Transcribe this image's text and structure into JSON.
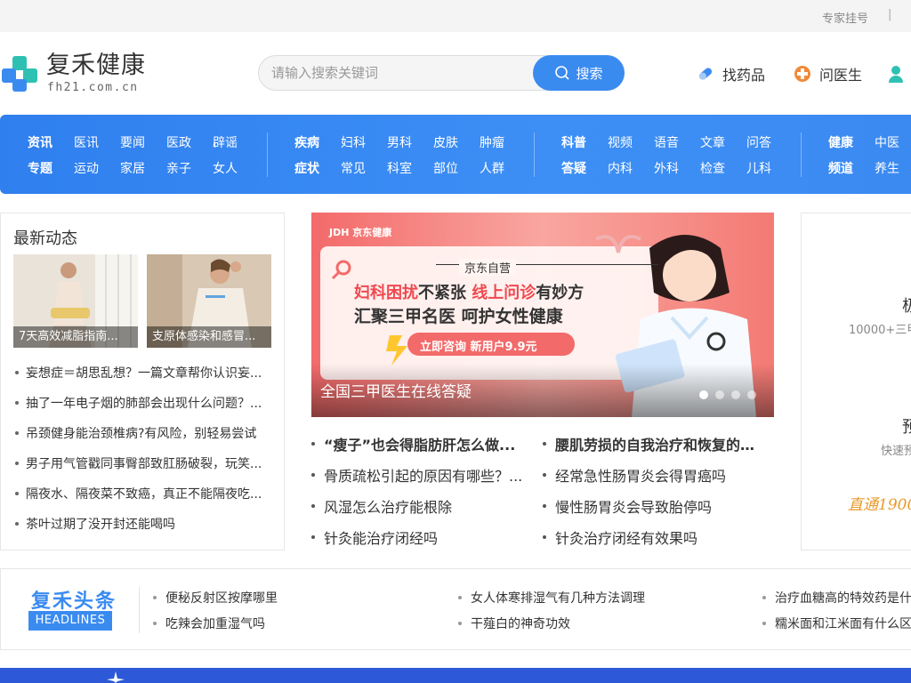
{
  "topbar": {
    "register": "专家挂号",
    "separator": "|"
  },
  "logo": {
    "name": "复禾健康",
    "domain": "fh21.com.cn"
  },
  "search": {
    "placeholder": "请输入搜索关键词",
    "button": "搜索"
  },
  "header_links": [
    {
      "label": "找药品",
      "icon": "pill-icon"
    },
    {
      "label": "问医生",
      "icon": "doctor-icon"
    }
  ],
  "nav": {
    "groups": [
      {
        "row1": [
          "资讯",
          "医讯",
          "要闻",
          "医政",
          "辟谣"
        ],
        "row2": [
          "专题",
          "运动",
          "家居",
          "亲子",
          "女人"
        ]
      },
      {
        "row1": [
          "疾病",
          "妇科",
          "男科",
          "皮肤",
          "肿瘤"
        ],
        "row2": [
          "症状",
          "常见",
          "科室",
          "部位",
          "人群"
        ]
      },
      {
        "row1": [
          "科普",
          "视频",
          "语音",
          "文章",
          "问答"
        ],
        "row2": [
          "答疑",
          "内科",
          "外科",
          "检查",
          "儿科"
        ]
      },
      {
        "row1": [
          "健康",
          "中医"
        ],
        "row2": [
          "频道",
          "养生"
        ]
      }
    ]
  },
  "latest": {
    "title": "最新动态",
    "thumbs": [
      "7天高效减脂指南...",
      "支原体感染和感冒..."
    ],
    "items": [
      "妄想症＝胡思乱想？一篇文章帮你认识妄...",
      "抽了一年电子烟的肺部会出现什么问题？...",
      "吊颈健身能治颈椎病?有风险，别轻易尝试",
      "男子用气管戳同事臀部致肛肠破裂，玩笑...",
      "隔夜水、隔夜菜不致癌，真正不能隔夜吃...",
      "茶叶过期了没开封还能喝吗"
    ]
  },
  "banner": {
    "brand": "JDH 京东健康",
    "tagline": "京东自营",
    "line1a": "妇科困扰",
    "line1b": "不紧张",
    "line1c": "线上问诊",
    "line1d": "有妙方",
    "line2": "汇聚三甲名医 呵护女性健康",
    "cta": "立即咨询 新用户9.9元",
    "caption": "全国三甲医生在线答疑"
  },
  "mid_list": {
    "left": [
      "“瘦子”也会得脂肪肝怎么做...",
      "骨质疏松引起的原因有哪些？...",
      "风湿怎么治疗能根除",
      "针灸能治疗闭经吗"
    ],
    "right": [
      "腰肌劳损的自我治疗和恢复的...",
      "经常急性肠胃炎会得胃癌吗",
      "慢性肠胃炎会导致胎停吗",
      "针灸治疗闭经有效果吗"
    ]
  },
  "right_panel": {
    "t1": "极",
    "s1": "10000+三甲",
    "t2": "预",
    "s2": "快速预",
    "s3": "直通1900"
  },
  "headlines": {
    "logo_cn": "复禾头条",
    "logo_en": "HEADLINES",
    "row1": [
      "便秘反射区按摩哪里",
      "女人体寒排湿气有几种方法调理",
      "治疗血糖高的特效药是什"
    ],
    "row2": [
      "吃辣会加重湿气吗",
      "干薤白的神奇功效",
      "糯米面和江米面有什么区"
    ]
  },
  "colors": {
    "brand": "#3a8bf0",
    "nav": "#2f7fef",
    "footer": "#2d59d8"
  }
}
